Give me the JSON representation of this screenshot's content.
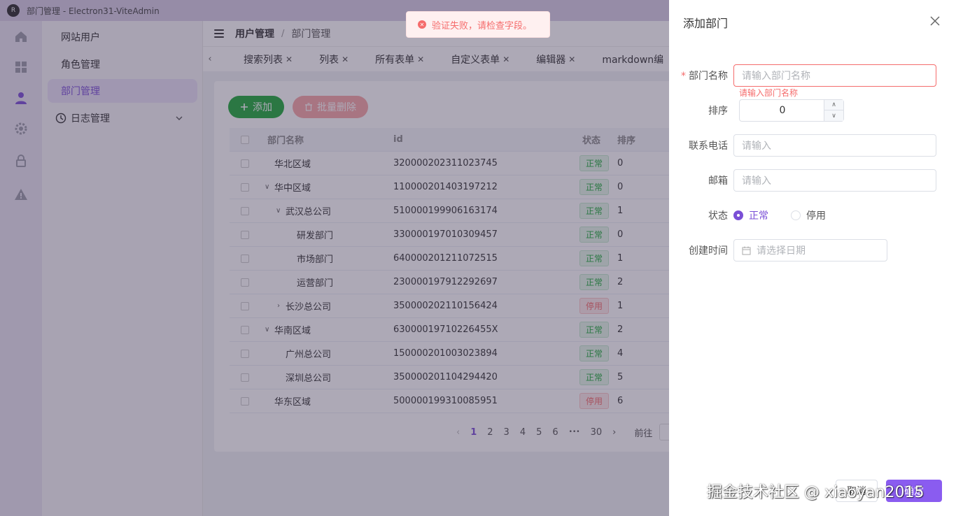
{
  "window": {
    "title": "部门管理 - Electron31-ViteAdmin",
    "logo_text": "R"
  },
  "rail": {
    "icons": [
      "home-icon",
      "grid-icon",
      "user-icon",
      "gear-icon",
      "lock-icon",
      "warning-icon"
    ],
    "active": "user-icon"
  },
  "menu": {
    "items": [
      {
        "label": "网站用户"
      },
      {
        "label": "角色管理"
      },
      {
        "label": "部门管理",
        "active": true
      },
      {
        "label": "日志管理",
        "has_children": true
      }
    ]
  },
  "breadcrumb": {
    "parent": "用户管理",
    "separator": "/",
    "current": "部门管理"
  },
  "tabs": [
    {
      "label": "搜索列表"
    },
    {
      "label": "列表"
    },
    {
      "label": "所有表单"
    },
    {
      "label": "自定义表单"
    },
    {
      "label": "编辑器"
    },
    {
      "label": "markdown编"
    }
  ],
  "toolbar": {
    "add_label": "添加",
    "batch_delete_label": "批量删除"
  },
  "table": {
    "columns": {
      "name": "部门名称",
      "id": "id",
      "status": "状态",
      "sort": "排序"
    },
    "rows": [
      {
        "name": "华北区域",
        "id": "320000202311023745",
        "status": "正常",
        "status_type": "ok",
        "sort": "0",
        "level": 0,
        "expander": ""
      },
      {
        "name": "华中区域",
        "id": "110000201403197212",
        "status": "正常",
        "status_type": "ok",
        "sort": "0",
        "level": 0,
        "expander": "open"
      },
      {
        "name": "武汉总公司",
        "id": "510000199906163174",
        "status": "正常",
        "status_type": "ok",
        "sort": "1",
        "level": 1,
        "expander": "open"
      },
      {
        "name": "研发部门",
        "id": "330000197010309457",
        "status": "正常",
        "status_type": "ok",
        "sort": "0",
        "level": 2,
        "expander": ""
      },
      {
        "name": "市场部门",
        "id": "640000201211072515",
        "status": "正常",
        "status_type": "ok",
        "sort": "1",
        "level": 2,
        "expander": ""
      },
      {
        "name": "运营部门",
        "id": "230000197912292697",
        "status": "正常",
        "status_type": "ok",
        "sort": "2",
        "level": 2,
        "expander": ""
      },
      {
        "name": "长沙总公司",
        "id": "350000202110156424",
        "status": "停用",
        "status_type": "stop",
        "sort": "1",
        "level": 1,
        "expander": "closed"
      },
      {
        "name": "华南区域",
        "id": "63000019710226455X",
        "status": "正常",
        "status_type": "ok",
        "sort": "2",
        "level": 0,
        "expander": "open"
      },
      {
        "name": "广州总公司",
        "id": "150000201003023894",
        "status": "正常",
        "status_type": "ok",
        "sort": "4",
        "level": 1,
        "expander": ""
      },
      {
        "name": "深圳总公司",
        "id": "350000201104294420",
        "status": "正常",
        "status_type": "ok",
        "sort": "5",
        "level": 1,
        "expander": ""
      },
      {
        "name": "华东区域",
        "id": "500000199310085951",
        "status": "停用",
        "status_type": "stop",
        "sort": "6",
        "level": 0,
        "expander": ""
      }
    ]
  },
  "pagination": {
    "prev": "‹",
    "pages": [
      "1",
      "2",
      "3",
      "4",
      "5",
      "6"
    ],
    "current": "1",
    "ellipsis": "•••",
    "last": "30",
    "next": "›",
    "goto_label": "前往"
  },
  "toast": {
    "text": "验证失败，请检查字段。",
    "icon": "error-icon",
    "color": "#f56c6c"
  },
  "drawer": {
    "title": "添加部门",
    "fields": {
      "dept_name": {
        "label": "部门名称",
        "required_mark": "*",
        "placeholder": "请输入部门名称",
        "error": "请输入部门名称"
      },
      "sort": {
        "label": "排序",
        "value": "0",
        "up": "∧",
        "down": "∨"
      },
      "phone": {
        "label": "联系电话",
        "placeholder": "请输入"
      },
      "email": {
        "label": "邮箱",
        "placeholder": "请输入"
      },
      "status": {
        "label": "状态",
        "options": [
          "正常",
          "停用"
        ],
        "selected": "正常"
      },
      "created": {
        "label": "创建时间",
        "placeholder": "请选择日期"
      }
    },
    "footer": {
      "cancel_label": "取消",
      "ok_label": "确定"
    }
  },
  "watermark": {
    "text": "掘金技术社区 @ xiaoyan2015"
  },
  "colors": {
    "accent": "#7a4fd6",
    "success": "#1faa3a",
    "danger": "#f56c6c",
    "primary_button": "#8a5cf0"
  }
}
